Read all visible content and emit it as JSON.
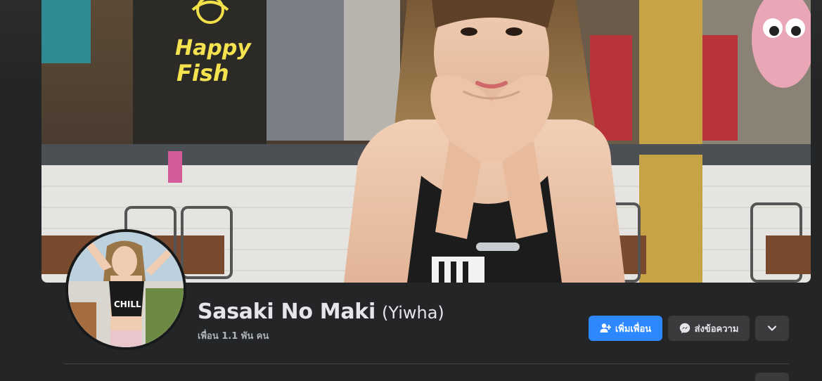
{
  "profile": {
    "name": "Sasaki No Maki",
    "alt_name": "(Yiwha)",
    "friends": "เพื่อน 1.1 พัน คน",
    "cover_sign_text": [
      "Happy",
      "Fish"
    ],
    "avatar_shirt_text": "CHILL"
  },
  "actions": {
    "add_friend": "เพิ่มเพื่อน",
    "add_friend_icon": "person-add-icon",
    "message": "ส่งข้อความ",
    "message_icon": "messenger-icon",
    "more_icon": "chevron-down-icon"
  },
  "colors": {
    "primary": "#2d88ff",
    "surface": "#242526",
    "button_secondary": "#3a3b3c",
    "text_primary": "#e4e6eb",
    "text_secondary": "#b0b3b8"
  }
}
